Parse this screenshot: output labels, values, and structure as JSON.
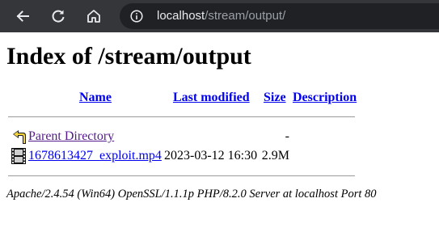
{
  "browser": {
    "url_host": "localhost",
    "url_path": "/stream/output/",
    "icons": {
      "back": "back-arrow-icon",
      "reload": "reload-icon",
      "home": "home-icon",
      "site_info": "info-icon"
    },
    "colors": {
      "toolbar_bg": "#35363a",
      "omnibox_bg": "#202124",
      "url_host": "#e8eaed",
      "url_path": "#9aa0a6"
    }
  },
  "page": {
    "title": "Index of /stream/output",
    "columns": {
      "name": "Name",
      "last_modified": "Last modified",
      "size": "Size",
      "description": "Description"
    },
    "rows": [
      {
        "icon": "back-folder-icon",
        "name": "Parent Directory",
        "last_modified": "",
        "size": "-",
        "description": ""
      },
      {
        "icon": "movie-icon",
        "name": "1678613427_exploit.mp4",
        "last_modified": "2023-03-12 16:30",
        "size": "2.9M",
        "description": ""
      }
    ],
    "address": "Apache/2.4.54 (Win64) OpenSSL/1.1.1p PHP/8.2.0 Server at localhost Port 80",
    "colors": {
      "link": "#0000ee",
      "visited_link": "#551a8b"
    }
  }
}
